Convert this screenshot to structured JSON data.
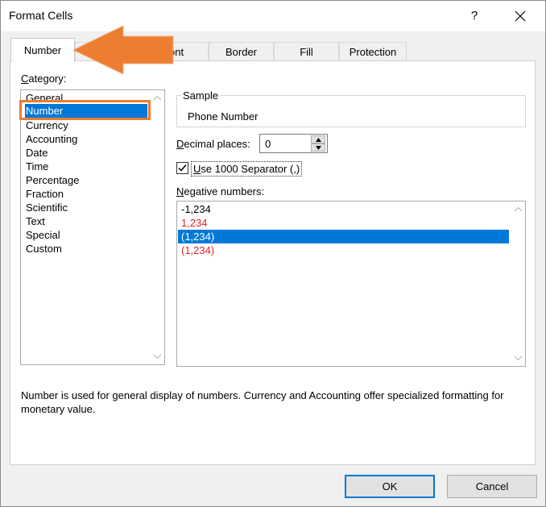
{
  "window": {
    "title": "Format Cells",
    "help_label": "?"
  },
  "tabs": [
    {
      "label": "Number",
      "active": true
    },
    {
      "label": "ont",
      "active": false
    },
    {
      "label": "Border",
      "active": false
    },
    {
      "label": "Fill",
      "active": false
    },
    {
      "label": "Protection",
      "active": false
    }
  ],
  "category": {
    "label_first": "C",
    "label_rest": "ategory:",
    "items": [
      "General",
      "Number",
      "Currency",
      "Accounting",
      "Date",
      "Time",
      "Percentage",
      "Fraction",
      "Scientific",
      "Text",
      "Special",
      "Custom"
    ],
    "selected": "Number"
  },
  "sample": {
    "legend": "Sample",
    "value": "Phone Number"
  },
  "decimal_places": {
    "label_first": "D",
    "label_rest": "ecimal places:",
    "value": "0"
  },
  "separator": {
    "checked": true,
    "label_first": "U",
    "label_rest": "se 1000 Separator (,)"
  },
  "negative_numbers": {
    "label_first": "N",
    "label_rest": "egative numbers:",
    "items": [
      {
        "text": "-1,234",
        "color": "#000000"
      },
      {
        "text": "1,234",
        "color": "#e0242b"
      },
      {
        "text": "(1,234)",
        "color": "#000000"
      },
      {
        "text": "(1,234)",
        "color": "#e0242b"
      }
    ],
    "selected_index": 2
  },
  "description": "Number is used for general display of numbers.  Currency and Accounting offer specialized formatting for monetary value.",
  "buttons": {
    "ok": "OK",
    "cancel": "Cancel"
  },
  "colors": {
    "selection": "#0078d7",
    "annotation": "#ed7d31",
    "negative_red": "#e0242b"
  },
  "icons": {
    "close": "close-icon",
    "help": "help-icon",
    "scroll_up": "chevron-up-icon",
    "scroll_down": "chevron-down-icon",
    "checkmark": "checkmark-icon",
    "annotation_arrow": "arrow-left-icon"
  }
}
